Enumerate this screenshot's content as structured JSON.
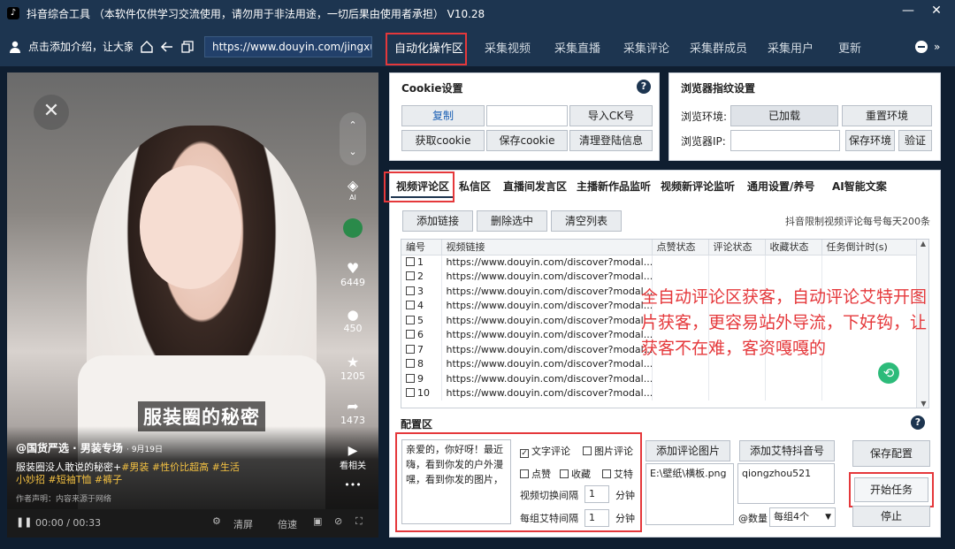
{
  "app": {
    "title": "抖音综合工具 （本软件仅供学习交流使用，请勿用于非法用途，一切后果由使用者承担） V10.28",
    "min": "—",
    "close": "✕"
  },
  "nav": {
    "user_text": "点击添加介绍，让大家认",
    "url": "https://www.douyin.com/jingxuan",
    "tabs": [
      "自动化操作区",
      "采集视频",
      "采集直播",
      "采集评论",
      "采集群成员",
      "采集用户",
      "更新"
    ]
  },
  "video": {
    "side": [
      "6449",
      "450",
      "1205",
      "1473",
      "看相关"
    ],
    "caption": "服装圈的秘密",
    "author": "@国货严选 · 男装专场",
    "date": "· 9月19日",
    "desc": "服装圈没人敢说的秘密+",
    "tags1": "#男装  #性价比超高  #生活",
    "tags2": "小妙招  #短袖T恤  #裤子",
    "notice": "作者声明：内容来源于网络",
    "time": "00:00 / 00:33",
    "ctrl": [
      "清屏",
      "倍速"
    ],
    "ai": "AI"
  },
  "cookie": {
    "title": "Cookie设置",
    "copy": "复制",
    "import": "导入CK号",
    "get": "获取cookie",
    "save": "保存cookie",
    "clear": "清理登陆信息"
  },
  "browser": {
    "title": "浏览器指纹设置",
    "env_label": "浏览环境:",
    "env_value": "已加载",
    "reset": "重置环境",
    "ip_label": "浏览器IP:",
    "save_env": "保存环境",
    "verify": "验证"
  },
  "subtabs": [
    "视频评论区",
    "私信区",
    "直播间发言区",
    "主播新作品监听",
    "视频新评论监听",
    "通用设置/养号",
    "AI智能文案"
  ],
  "toolbar": {
    "add": "添加链接",
    "del": "删除选中",
    "clear": "清空列表",
    "note": "抖音限制视频评论每号每天200条"
  },
  "table": {
    "headers": [
      "编号",
      "视频链接",
      "点赞状态",
      "评论状态",
      "收藏状态",
      "任务倒计时(s)"
    ],
    "link": "https://www.douyin.com/discover?modal...",
    "rows": [
      "1",
      "2",
      "3",
      "4",
      "5",
      "6",
      "7",
      "8",
      "9",
      "10"
    ]
  },
  "overlay": "全自动评论区获客，自动评论艾特开图片获客，更容易站外导流，下好钩，让获客不在难，客资嘎嘎的",
  "config": {
    "title": "配置区",
    "lines": [
      "亲爱的，你好呀！最近",
      "嗨，看到你发的户外漫",
      "嘿，看到你发的图片，"
    ],
    "text_comment": "文字评论",
    "img_comment": "图片评论",
    "like": "点赞",
    "fav": "收藏",
    "at": "艾特",
    "switch_label": "视频切换间隔",
    "switch_val": "1",
    "unit": "分钟",
    "at_label": "每组艾特间隔",
    "at_val": "1",
    "add_img": "添加评论图片",
    "img_path": "E:\\壁纸\\横板.png",
    "add_at": "添加艾特抖音号",
    "at_account": "qiongzhou521",
    "count_label": "@数量",
    "count_val": "每组4个",
    "save": "保存配置",
    "start": "开始任务",
    "stop": "停止"
  }
}
